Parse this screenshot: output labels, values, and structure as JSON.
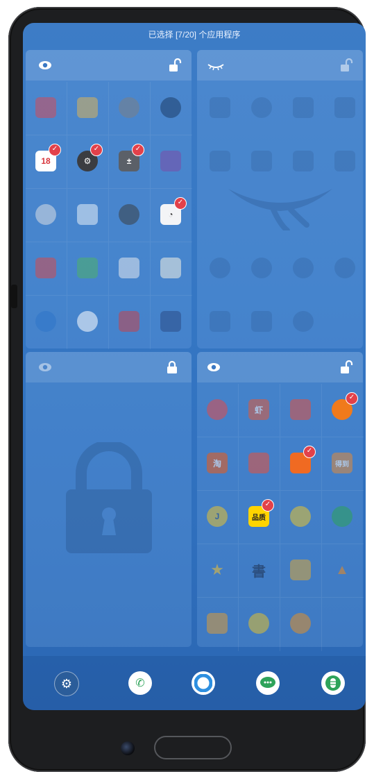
{
  "status": {
    "title": "已选择 [7/20] 个应用程序"
  },
  "colors": {
    "accent": "#e2414a",
    "screen_top": "#3d7cc6",
    "screen_bottom": "#2b66b2"
  },
  "panels": {
    "top_left": {
      "header_left_icon": "eye-icon",
      "header_right_icon": "unlocked-padlock-icon"
    },
    "top_right": {
      "header_left_icon": "closed-eye-icon",
      "header_right_icon": "unlocked-padlock-icon"
    },
    "bottom_left": {
      "header_left_icon": "eye-icon",
      "header_right_icon": "locked-padlock-icon"
    },
    "bottom_right": {
      "header_left_icon": "eye-icon",
      "header_right_icon": "unlocked-padlock-icon"
    }
  },
  "apps_bottom_right_text": {
    "xia": "虾",
    "taobao": "淘",
    "dedao": "得到"
  },
  "calendar_day": "18",
  "dock": [
    {
      "name": "settings",
      "icon": "gear-icon"
    },
    {
      "name": "phone",
      "icon": "phone-icon"
    },
    {
      "name": "browser",
      "icon": "browser-icon"
    },
    {
      "name": "messages",
      "icon": "message-icon"
    },
    {
      "name": "smartisan",
      "icon": "capsule-icon"
    }
  ]
}
